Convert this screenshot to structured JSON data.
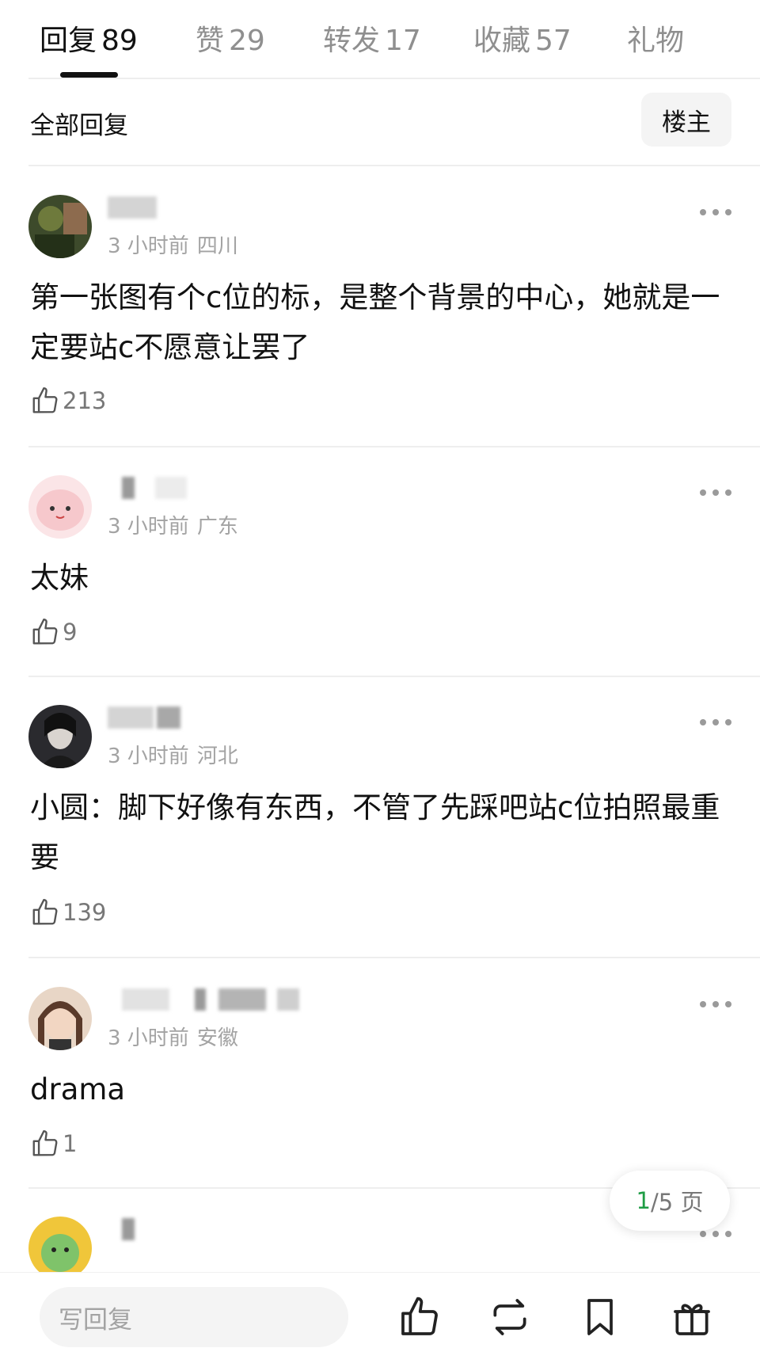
{
  "tabs": [
    {
      "label": "回复",
      "count": "89",
      "active": true
    },
    {
      "label": "赞",
      "count": "29",
      "active": false
    },
    {
      "label": "转发",
      "count": "17",
      "active": false
    },
    {
      "label": "收藏",
      "count": "57",
      "active": false
    },
    {
      "label": "礼物",
      "count": "",
      "active": false
    }
  ],
  "section": {
    "title": "全部回复",
    "filter_button": "楼主"
  },
  "comments": [
    {
      "time": "3 小时前",
      "region": "四川",
      "text": "第一张图有个c位的标，是整个背景的中心，她就是一定要站c不愿意让罢了",
      "likes": "213",
      "avatar_color": "#3d4a2b"
    },
    {
      "time": "3 小时前",
      "region": "广东",
      "text": "太妹",
      "likes": "9",
      "avatar_color": "#f6d3d6"
    },
    {
      "time": "3 小时前",
      "region": "河北",
      "text": "小圆：脚下好像有东西，不管了先踩吧站c位拍照最重要",
      "likes": "139",
      "avatar_color": "#2a2a2e"
    },
    {
      "time": "3 小时前",
      "region": "安徽",
      "text": "drama",
      "likes": "1",
      "avatar_color": "#c9a98f"
    }
  ],
  "pager": {
    "current": "1",
    "total": "/5 页"
  },
  "bottom_bar": {
    "reply_placeholder": "写回复",
    "icons": [
      "thumbs-up-icon",
      "repost-icon",
      "bookmark-icon",
      "gift-icon"
    ]
  },
  "colors": {
    "accent_green": "#1f9d45",
    "muted_text": "#a3a3a3",
    "divider": "#eeeeee"
  }
}
